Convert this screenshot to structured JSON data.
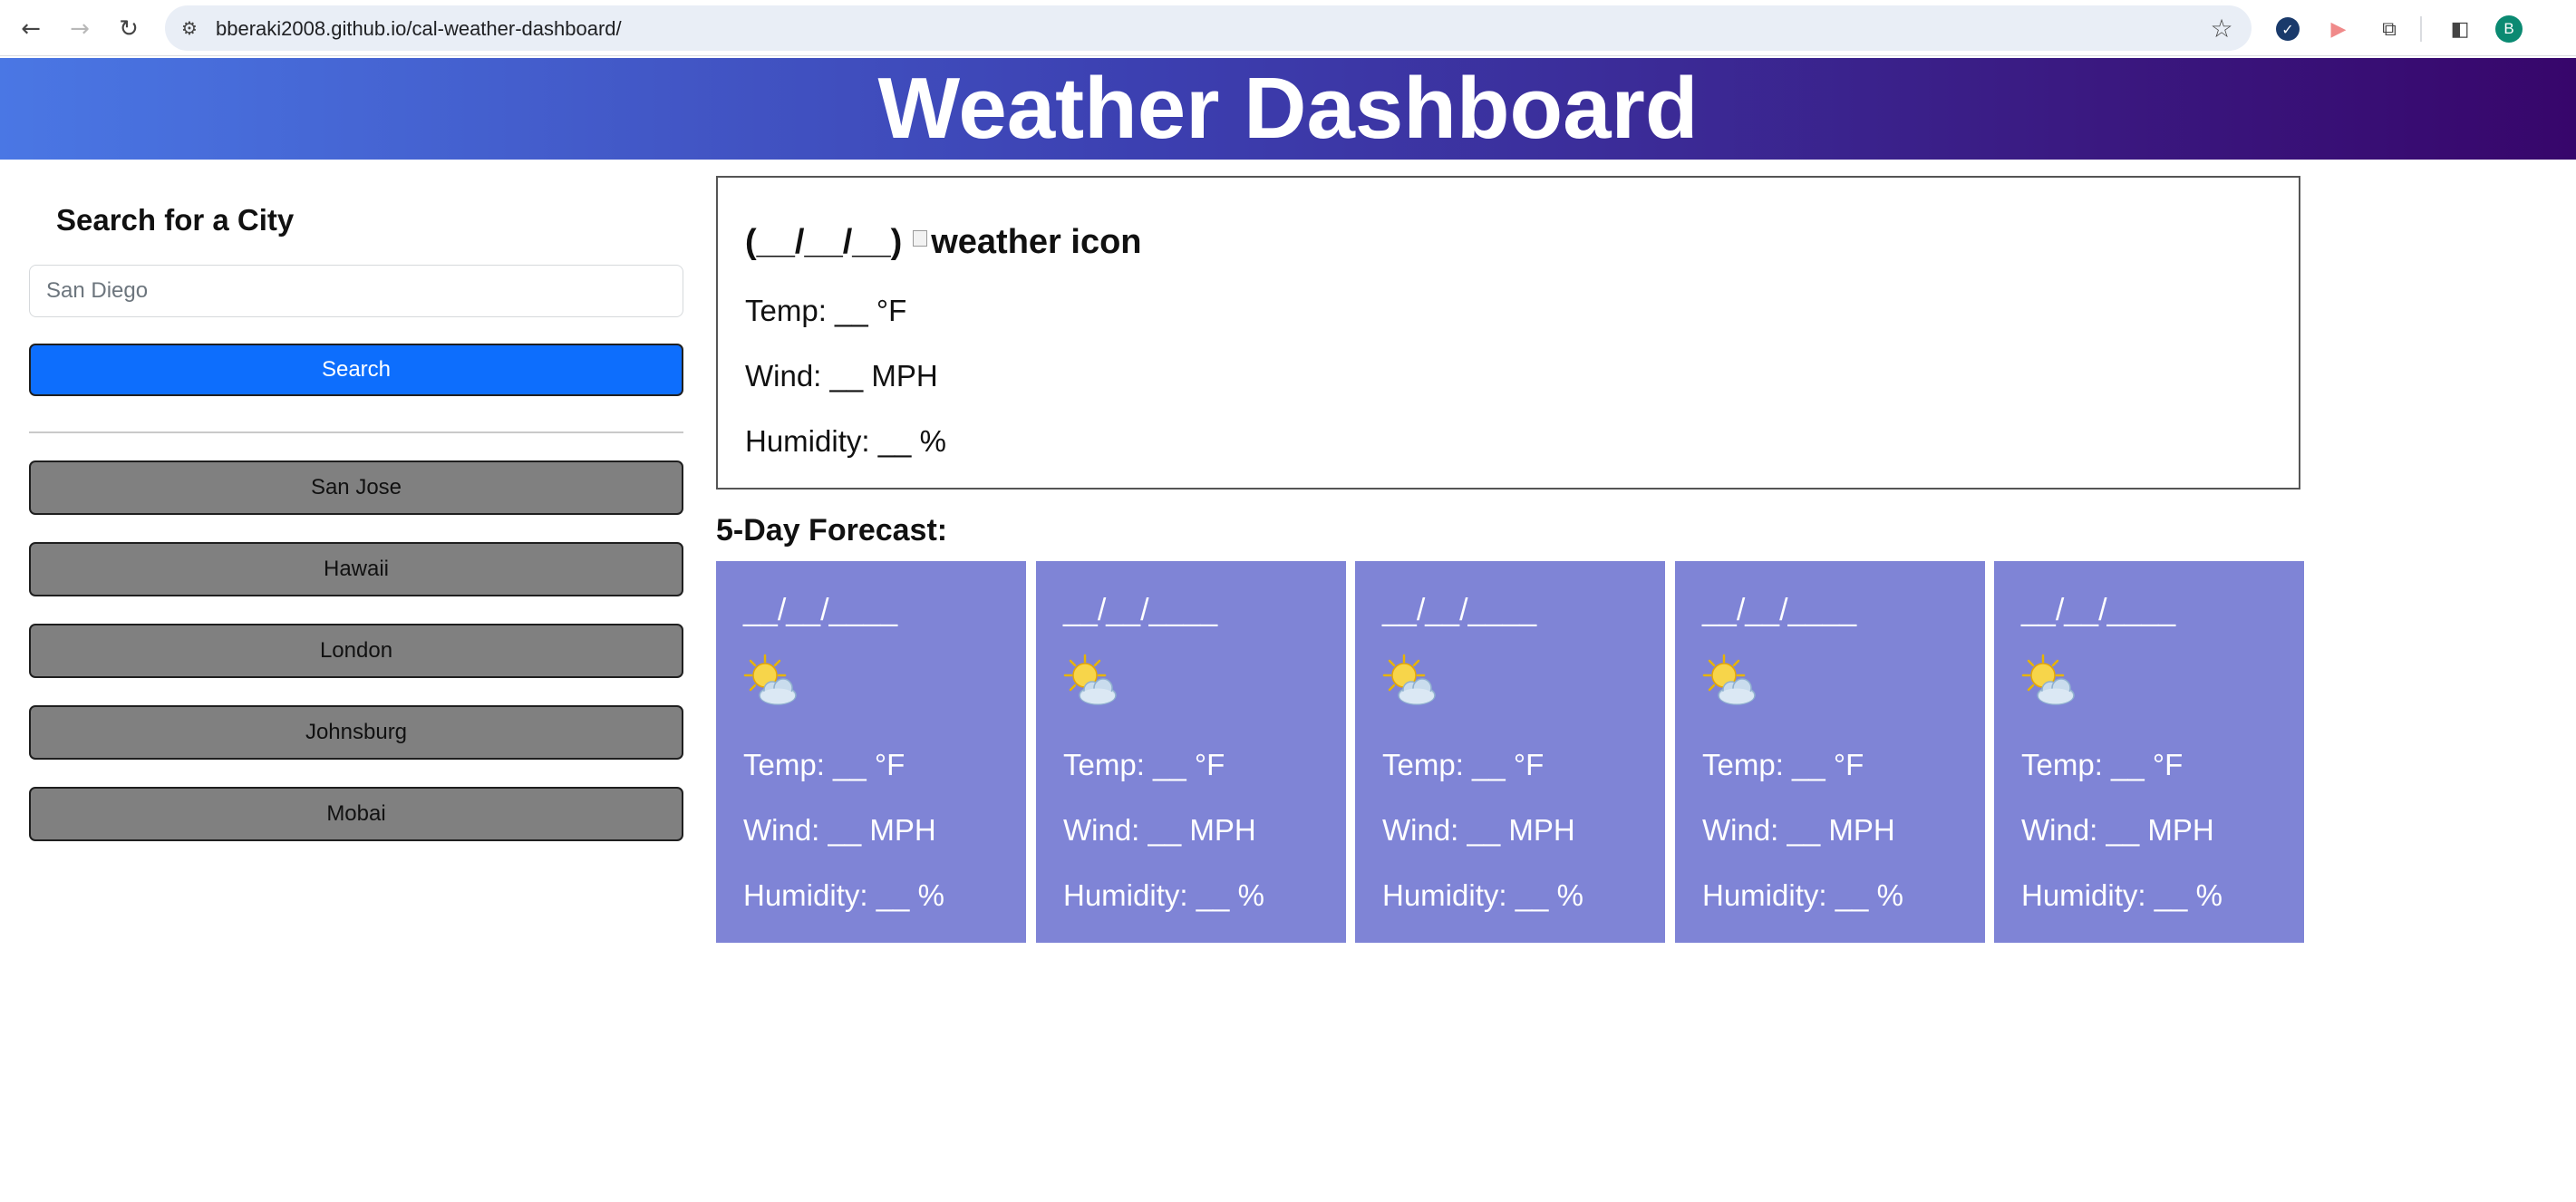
{
  "browser": {
    "url": "bberaki2008.github.io/cal-weather-dashboard/",
    "back_icon": "←",
    "forward_icon": "→",
    "reload_icon": "↻",
    "site_info_icon": "⚙",
    "star_icon": "☆",
    "ext_check_icon": "✓",
    "ext_play_icon": "▶",
    "ext_puzzle_icon": "⧉",
    "side_panel_icon": "◧",
    "avatar_letter": "B"
  },
  "header": {
    "title": "Weather Dashboard"
  },
  "sidebar": {
    "heading": "Search for a City",
    "input_value": "San Diego",
    "search_label": "Search",
    "history": [
      "San Jose",
      "Hawaii",
      "London",
      "Johnsburg",
      "Mobai"
    ]
  },
  "current": {
    "date": "(__/__/__)",
    "icon_alt": "weather icon",
    "temp": "Temp: __ °F",
    "wind": "Wind: __ MPH",
    "humidity": "Humidity: __ %"
  },
  "forecast": {
    "heading": "5-Day Forecast:",
    "days": [
      {
        "date": "__/__/____",
        "temp": "Temp: __ °F",
        "wind": "Wind: __ MPH",
        "humidity": "Humidity: __ %"
      },
      {
        "date": "__/__/____",
        "temp": "Temp: __ °F",
        "wind": "Wind: __ MPH",
        "humidity": "Humidity: __ %"
      },
      {
        "date": "__/__/____",
        "temp": "Temp: __ °F",
        "wind": "Wind: __ MPH",
        "humidity": "Humidity: __ %"
      },
      {
        "date": "__/__/____",
        "temp": "Temp: __ °F",
        "wind": "Wind: __ MPH",
        "humidity": "Humidity: __ %"
      },
      {
        "date": "__/__/____",
        "temp": "Temp: __ °F",
        "wind": "Wind: __ MPH",
        "humidity": "Humidity: __ %"
      }
    ]
  },
  "colors": {
    "header_start": "#4a77e4",
    "header_end": "#37066b",
    "search_button": "#0d6efd",
    "history_button": "#808080",
    "forecast_card": "#7f84d6"
  }
}
